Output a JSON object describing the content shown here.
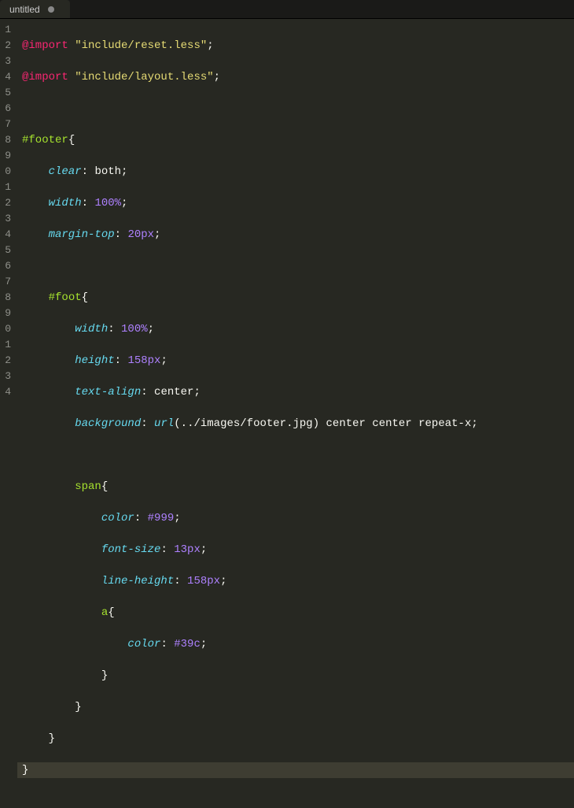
{
  "tab": {
    "title": "untitled",
    "modified": true
  },
  "gutter": {
    "numbers": [
      "1",
      "2",
      "3",
      "4",
      "5",
      "6",
      "7",
      "8",
      "9",
      "0",
      "1",
      "2",
      "3",
      "4",
      "5",
      "6",
      "7",
      "8",
      "9",
      "0",
      "1",
      "2",
      "3",
      "4"
    ]
  },
  "code": {
    "l1_kw": "@import",
    "l1_str": "\"include/reset.less\"",
    "l1_end": ";",
    "l2_kw": "@import",
    "l2_str": "\"include/layout.less\"",
    "l2_end": ";",
    "l3": "",
    "l4_sel": "#footer",
    "l4_brace": "{",
    "l5_prop": "    clear",
    "l5_colon": ": ",
    "l5_val": "both",
    "l5_end": ";",
    "l6_prop": "    width",
    "l6_colon": ": ",
    "l6_val": "100%",
    "l6_end": ";",
    "l7_prop": "    margin-top",
    "l7_colon": ": ",
    "l7_val": "20px",
    "l7_end": ";",
    "l8": "",
    "l9_indent": "    ",
    "l9_sel": "#foot",
    "l9_brace": "{",
    "l10_prop": "        width",
    "l10_colon": ": ",
    "l10_val": "100%",
    "l10_end": ";",
    "l11_prop": "        height",
    "l11_colon": ": ",
    "l11_val": "158px",
    "l11_end": ";",
    "l12_prop": "        text-align",
    "l12_colon": ": ",
    "l12_val": "center",
    "l12_end": ";",
    "l13_prop": "        background",
    "l13_colon": ": ",
    "l13_fn": "url",
    "l13_args": "(../images/footer.jpg)",
    "l13_rest": " center center repeat-x",
    "l13_end": ";",
    "l14": "",
    "l15_indent": "        ",
    "l15_sel": "span",
    "l15_brace": "{",
    "l16_prop": "            color",
    "l16_colon": ": ",
    "l16_val": "#999",
    "l16_end": ";",
    "l17_prop": "            font-size",
    "l17_colon": ": ",
    "l17_val": "13px",
    "l17_end": ";",
    "l18_prop": "            line-height",
    "l18_colon": ": ",
    "l18_val": "158px",
    "l18_end": ";",
    "l19_indent": "            ",
    "l19_sel": "a",
    "l19_brace": "{",
    "l20_prop": "                color",
    "l20_colon": ": ",
    "l20_val": "#39c",
    "l20_end": ";",
    "l21": "            }",
    "l22": "        }",
    "l23": "    }",
    "l24": "}"
  }
}
